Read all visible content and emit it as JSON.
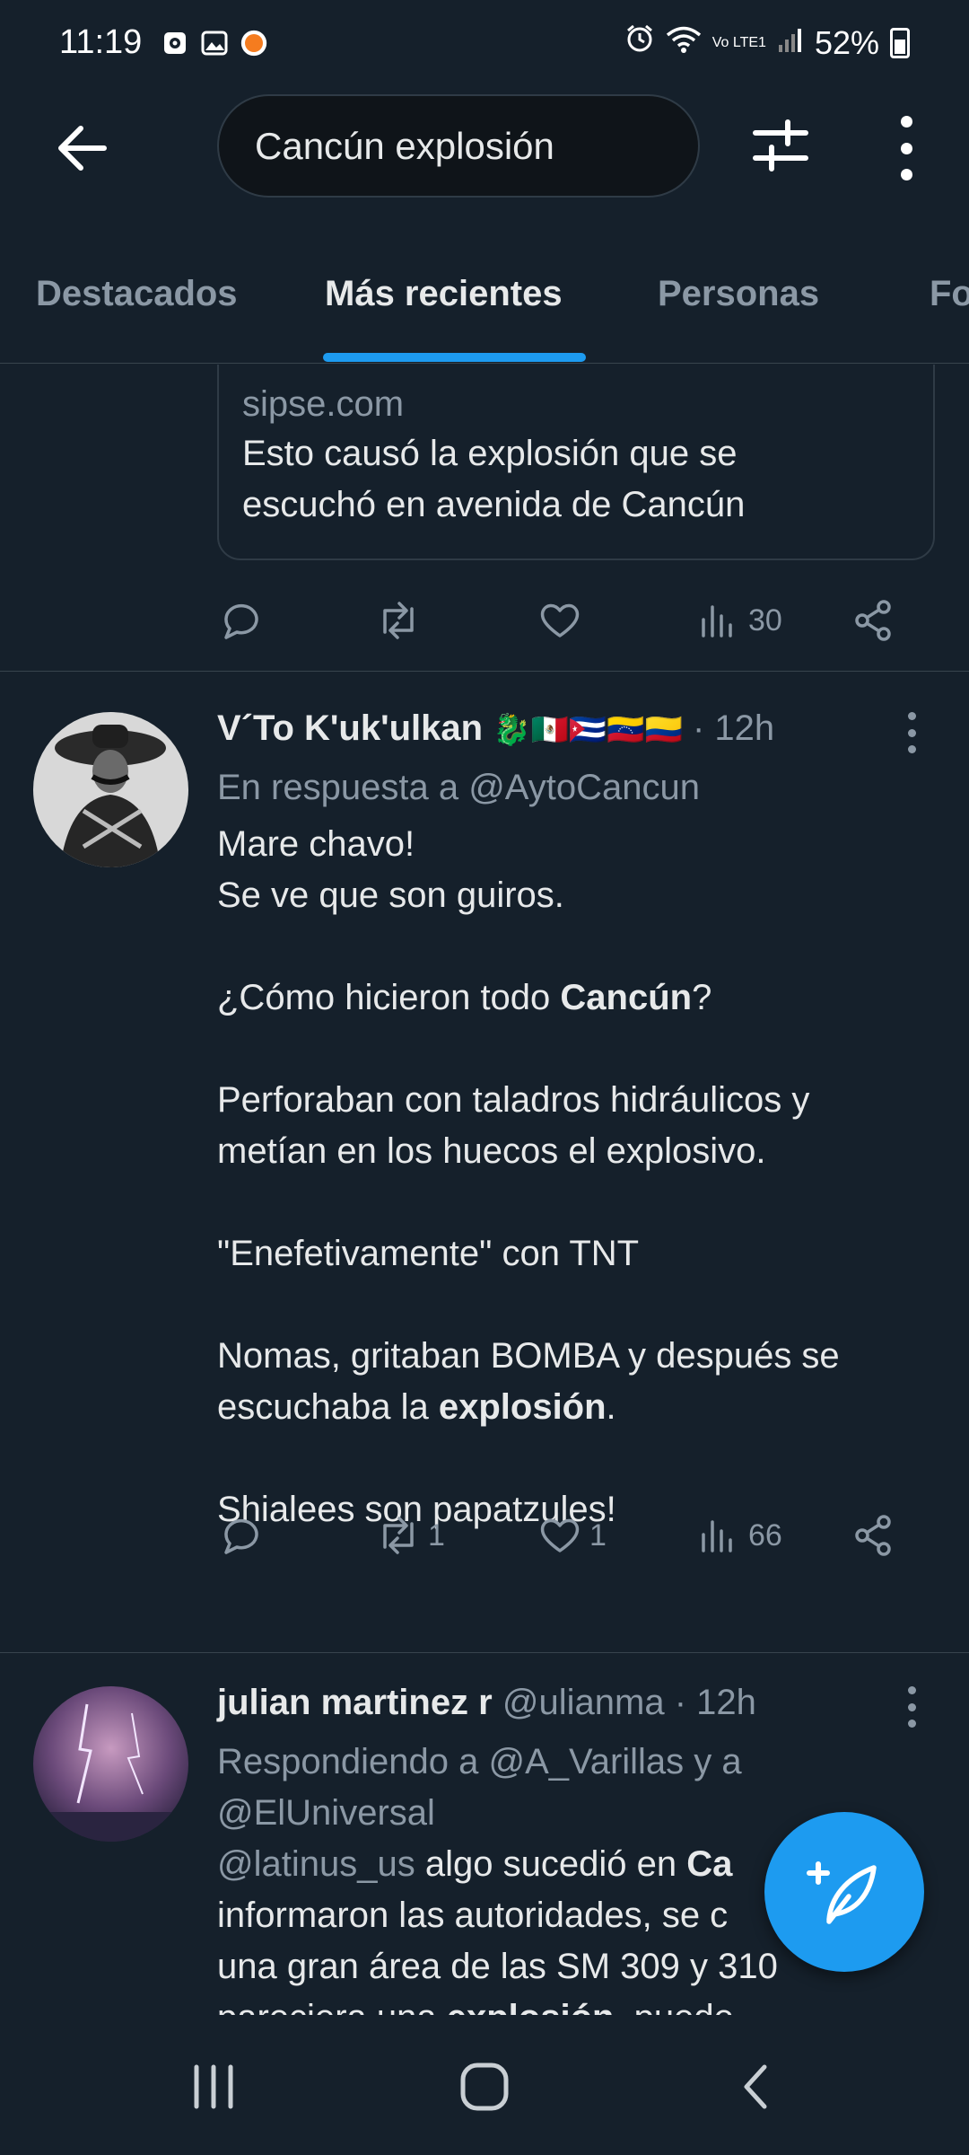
{
  "status_bar": {
    "time": "11:19",
    "network": "Vo LTE1",
    "battery": "52%"
  },
  "search": {
    "query": "Cancún explosión"
  },
  "tabs": [
    {
      "label": "Destacados",
      "active": false
    },
    {
      "label": "Más recientes",
      "active": true
    },
    {
      "label": "Personas",
      "active": false
    },
    {
      "label": "Fo",
      "active": false
    }
  ],
  "prev_tweet": {
    "link_domain": "sipse.com",
    "link_title_line1": "Esto causó la explosión que se",
    "link_title_line2": "escuchó en avenida de Cancún",
    "retweets": "",
    "likes": "",
    "views": "30"
  },
  "tweet1": {
    "name": "V´To K'uk'ulkan",
    "emoji": "🐉🇲🇽🇨🇺🇻🇪🇨🇴",
    "time": "· 12h",
    "reply_prefix": "En respuesta a",
    "reply_handle": "@AytoCancun",
    "line1": "Mare chavo!",
    "line2": "Se ve que son guiros.",
    "line3a": "¿Cómo hicieron todo ",
    "line3b": "Cancún",
    "line3c": "?",
    "line4": "Perforaban con taladros hidráulicos y",
    "line5": "metían en los huecos el explosivo.",
    "line6": "\"Enefetivamente\" con TNT",
    "line7": "Nomas, gritaban BOMBA y después  se",
    "line8a": "escuchaba la ",
    "line8b": "explosión",
    "line8c": ".",
    "line9": "Shialees son papatzules!",
    "retweets": "1",
    "likes": "1",
    "views": "66"
  },
  "tweet2": {
    "name": "julian martinez r",
    "handle": "@ulianma",
    "time": "· 12h",
    "reply_line1": "Respondiendo a @A_Varillas y a",
    "reply_line2": "@ElUniversal",
    "line1a": "@latinus_us",
    "line1b": " algo sucedió en ",
    "line1c": "Ca",
    "line2": "informaron las autoridades, se c",
    "line3": "una gran área de las SM 309 y 310",
    "line4a": "pareciera una ",
    "line4b": "explosión",
    "line4c": ", puede"
  },
  "colors": {
    "background": "#15202b",
    "accent": "#1d9bf0",
    "muted": "#8b98a5"
  }
}
